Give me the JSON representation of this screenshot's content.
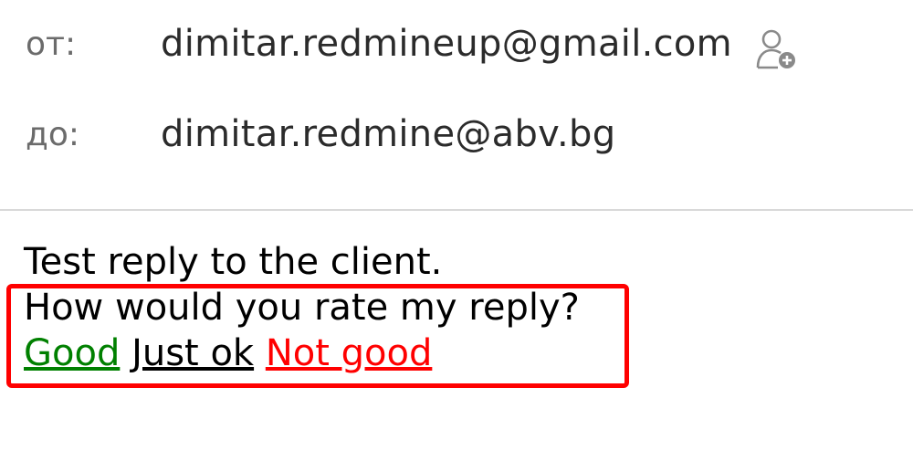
{
  "email_header": {
    "from": {
      "label": "от:",
      "value": "dimitar.redmineup@gmail.com"
    },
    "to": {
      "label": "до:",
      "value": "dimitar.redmine@abv.bg"
    },
    "add_contact_icon": "add-contact-icon"
  },
  "email_body": {
    "line1": "Test reply to the client.",
    "line2": "How would you rate my reply?",
    "ratings": {
      "good": "Good",
      "just_ok": "Just ok",
      "not_good": "Not good"
    }
  },
  "colors": {
    "highlight": "#ff0000",
    "good": "#008000",
    "just_ok": "#000000",
    "not_good": "#ff0000",
    "label": "#6b6b6b"
  }
}
